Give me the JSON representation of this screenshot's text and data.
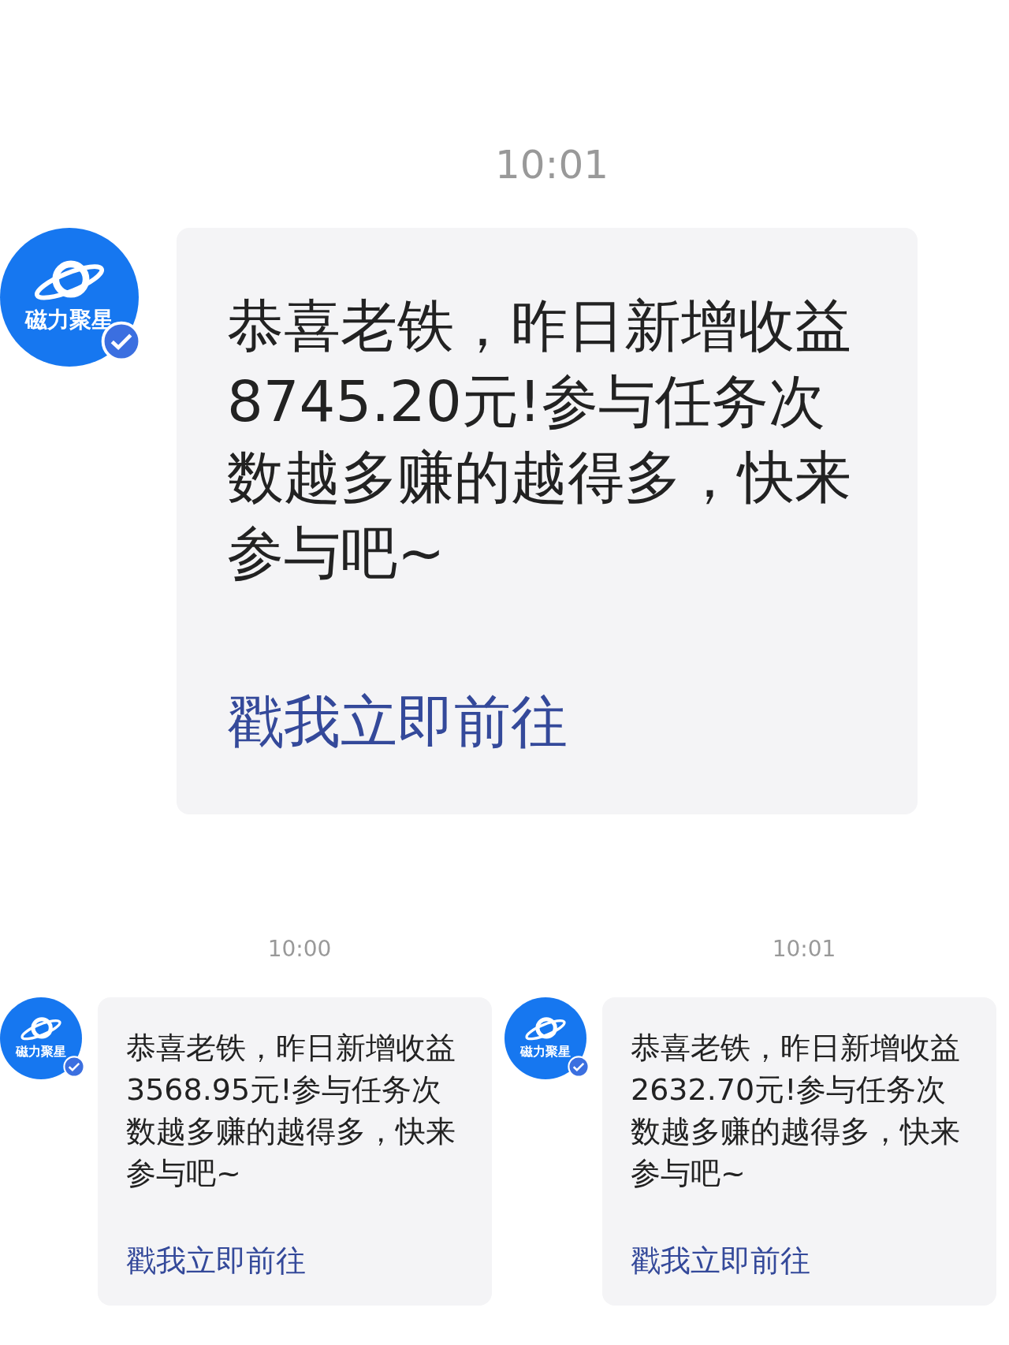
{
  "featured": {
    "time": "10:01",
    "avatar_label": "磁力聚星",
    "message_lines": [
      "恭喜老铁，昨日新增收益",
      "8745.20元!参与任务次",
      "数越多赚的越得多，快来",
      "参与吧~"
    ],
    "link": "戳我立即前往"
  },
  "messages": [
    {
      "time": "10:00",
      "avatar_label": "磁力聚星",
      "message_lines": [
        "恭喜老铁，昨日新增收益",
        "3568.95元!参与任务次",
        "数越多赚的越得多，快来",
        "参与吧~"
      ],
      "link": "戳我立即前往"
    },
    {
      "time": "10:01",
      "avatar_label": "磁力聚星",
      "message_lines": [
        "恭喜老铁，昨日新增收益",
        "2632.70元!参与任务次",
        "数越多赚的越得多，快来",
        "参与吧~"
      ],
      "link": "戳我立即前往"
    }
  ]
}
